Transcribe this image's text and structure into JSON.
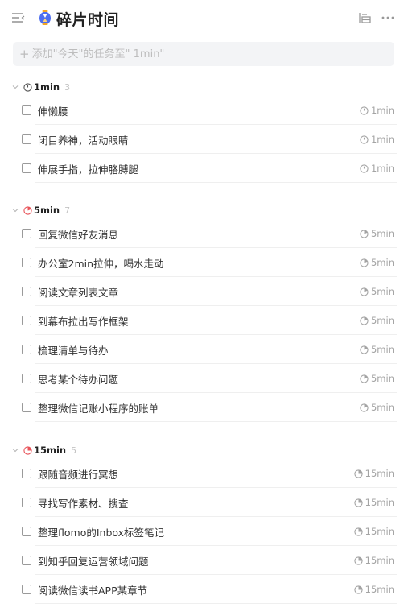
{
  "header": {
    "title": "碎片时间",
    "menu_icon": "hamburger-menu-icon",
    "title_icon": "hourglass-icon",
    "sort_icon": "sort-icon",
    "more_icon": "more-icon",
    "accent_color": "#4f6ff0"
  },
  "add_task": {
    "placeholder": "添加\"今天\"的任务至\" 1min\"",
    "value": ""
  },
  "sections": [
    {
      "label": "1min",
      "count": "3",
      "tasks": [
        {
          "title": "伸懒腰",
          "duration": "1min"
        },
        {
          "title": "闭目养神，活动眼睛",
          "duration": "1min"
        },
        {
          "title": "伸展手指，拉伸胳膊腿",
          "duration": "1min"
        }
      ]
    },
    {
      "label": "5min",
      "count": "7",
      "tasks": [
        {
          "title": "回复微信好友消息",
          "duration": "5min"
        },
        {
          "title": "办公室2min拉伸，喝水走动",
          "duration": "5min"
        },
        {
          "title": "阅读文章列表文章",
          "duration": "5min"
        },
        {
          "title": "到幕布拉出写作框架",
          "duration": "5min"
        },
        {
          "title": "梳理清单与待办",
          "duration": "5min"
        },
        {
          "title": "思考某个待办问题",
          "duration": "5min"
        },
        {
          "title": "整理微信记账小程序的账单",
          "duration": "5min"
        }
      ]
    },
    {
      "label": "15min",
      "count": "5",
      "tasks": [
        {
          "title": "跟随音频进行冥想",
          "duration": "15min"
        },
        {
          "title": "寻找写作素材、搜查",
          "duration": "15min"
        },
        {
          "title": "整理flomo的Inbox标签笔记",
          "duration": "15min"
        },
        {
          "title": "到知乎回复运营领域问题",
          "duration": "15min"
        },
        {
          "title": "阅读微信读书APP某章节",
          "duration": "15min"
        }
      ]
    }
  ]
}
